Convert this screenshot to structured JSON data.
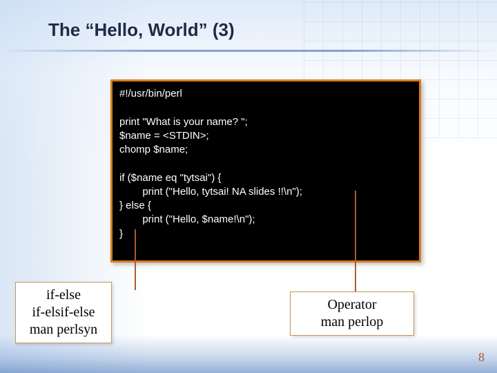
{
  "title": "The “Hello, World” (3)",
  "code": {
    "l1": "#!/usr/bin/perl",
    "l2": "",
    "l3": "print \"What is your name? \";",
    "l4": "$name = <STDIN>;",
    "l5": "chomp $name;",
    "l6": "",
    "l7": "if ($name eq \"tytsai\") {",
    "l8": "        print (\"Hello, tytsai! NA slides !!\\n\");",
    "l9": "} else {",
    "l10": "        print (\"Hello, $name!\\n\");",
    "l11": "}"
  },
  "annotations": {
    "left": {
      "line1": "if-else",
      "line2": "if-elsif-else",
      "line3": "man perlsyn"
    },
    "right": {
      "line1": "Operator",
      "line2": "man perlop"
    }
  },
  "page_number": "8"
}
